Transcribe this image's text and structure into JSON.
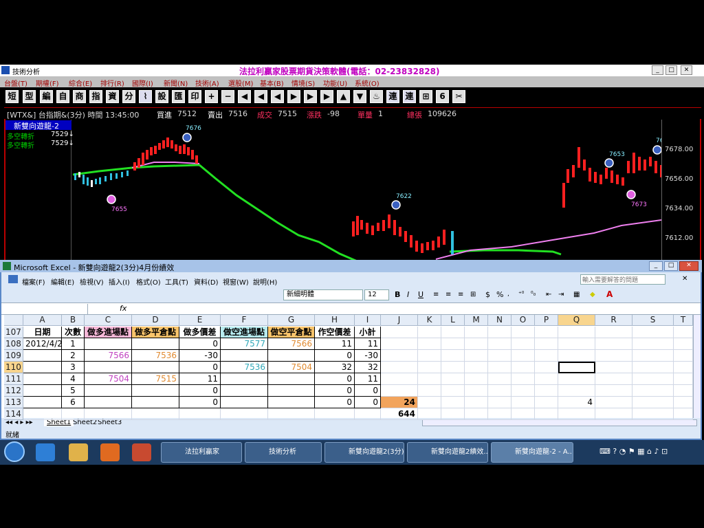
{
  "trading": {
    "window_title": "技術分析",
    "brand": "法拉利贏家股票期貨決策軟體(電話：02-23832828)",
    "menu": [
      "台盤(T)",
      "期權(F)",
      "綜合(E)",
      "排行(R)",
      "國際(I)",
      "新聞(N)",
      "技術(A)",
      "選股(M)",
      "基本(B)",
      "情境(S)",
      "功能(U)",
      "系統(O)"
    ],
    "tools": [
      "短",
      "型",
      "編",
      "自",
      "商",
      "指",
      "資",
      "分",
      "⌇",
      "設",
      "匯",
      "印",
      "+",
      "−",
      "◀",
      "◀",
      "◀",
      "▶",
      "▶",
      "▶",
      "▲",
      "▼",
      "♨",
      "連",
      "連",
      "⊞",
      "6",
      "✂"
    ],
    "info": {
      "symbol": "[WTX&] 台指期&(3分) 時間 13:45:00",
      "buy_label": "買進",
      "buy": "7512",
      "sell_label": "賣出",
      "sell": "7516",
      "deal_label": "成交",
      "deal": "7515",
      "chg_label": "漲跌",
      "chg": "-98",
      "vol_label": "單量",
      "vol": "1",
      "total_label": "總張",
      "total": "109626"
    },
    "strategy_name": "新雙向遊龍-2",
    "signals": [
      {
        "label": "多空轉折",
        "value": "7529↓"
      },
      {
        "label": "多空轉折",
        "value": "7529↓"
      }
    ],
    "price_ticks": [
      "7678.00",
      "7656.00",
      "7634.00",
      "7612.00"
    ],
    "markers": [
      "7676",
      "7655",
      "7622",
      "7653",
      "7673",
      "76"
    ]
  },
  "excel": {
    "title": "Microsoft Excel - 新雙向遊龍2(3分)4月份績效",
    "menu": [
      "檔案(F)",
      "編輯(E)",
      "檢視(V)",
      "插入(I)",
      "格式(O)",
      "工具(T)",
      "資料(D)",
      "視窗(W)",
      "說明(H)"
    ],
    "help_placeholder": "輸入需要解答的問題",
    "font_name": "新細明體",
    "font_size": "12",
    "fmt_buttons": [
      "B",
      "I",
      "U",
      "$",
      "%"
    ],
    "columns": [
      "A",
      "B",
      "C",
      "D",
      "E",
      "F",
      "G",
      "H",
      "I",
      "J",
      "K",
      "L",
      "M",
      "N",
      "O",
      "P",
      "Q",
      "R",
      "S",
      "T"
    ],
    "rows": [
      "107",
      "108",
      "109",
      "110",
      "111",
      "112",
      "113",
      "114"
    ],
    "headers": [
      "日期",
      "次數",
      "做多進場點",
      "做多平倉點",
      "做多價差",
      "做空進場點",
      "做空平倉點",
      "作空價差",
      "小計"
    ],
    "data": [
      [
        "2012/4/20",
        "1",
        "",
        "",
        "0",
        "7577",
        "7566",
        "11",
        "11"
      ],
      [
        "",
        "2",
        "7566",
        "7536",
        "-30",
        "",
        "",
        "0",
        "-30"
      ],
      [
        "",
        "3",
        "",
        "",
        "0",
        "7536",
        "7504",
        "32",
        "32"
      ],
      [
        "",
        "4",
        "7504",
        "7515",
        "11",
        "",
        "",
        "0",
        "11"
      ],
      [
        "",
        "5",
        "",
        "",
        "0",
        "",
        "",
        "0",
        "0"
      ],
      [
        "",
        "6",
        "",
        "",
        "0",
        "",
        "",
        "0",
        "0"
      ]
    ],
    "j113": "24",
    "j114": "644",
    "q113": "4",
    "sheets": [
      "Sheet1",
      "Sheet2",
      "Sheet3"
    ],
    "status": "就緒"
  },
  "taskbar": {
    "items": [
      "法拉利贏家",
      "技術分析",
      "新雙向遊龍2(3分)...",
      "新雙向遊龍2績效...",
      "新雙向遊龍-2 - A..."
    ]
  }
}
